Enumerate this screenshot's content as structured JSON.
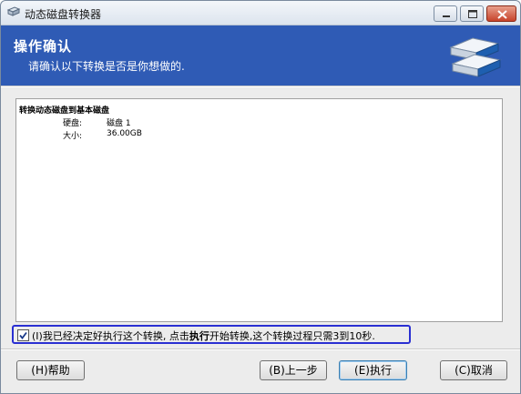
{
  "window": {
    "title": "动态磁盘转换器",
    "controls": {
      "minimize": "minimize",
      "maximize": "maximize",
      "close": "close"
    }
  },
  "header": {
    "title": "操作确认",
    "subtitle": "请确认以下转换是否是你想做的.",
    "icon": "disk-drives-icon",
    "background": "#2f5bb5"
  },
  "details": {
    "heading": "转换动态磁盘到基本磁盘",
    "rows": [
      {
        "label": "硬盘:",
        "value": "磁盘 1"
      },
      {
        "label": "大小:",
        "value": "36.00GB"
      }
    ]
  },
  "confirm": {
    "checked": true,
    "text_before": "(I)我已经决定好执行这个转换, 点击",
    "text_bold": "执行",
    "text_after": "开始转换,这个转换过程只需3到10秒."
  },
  "buttons": {
    "help": "(H)帮助",
    "back": "(B)上一步",
    "execute": "(E)执行",
    "cancel": "(C)取消"
  },
  "colors": {
    "focus_border": "#2a2fd2"
  }
}
